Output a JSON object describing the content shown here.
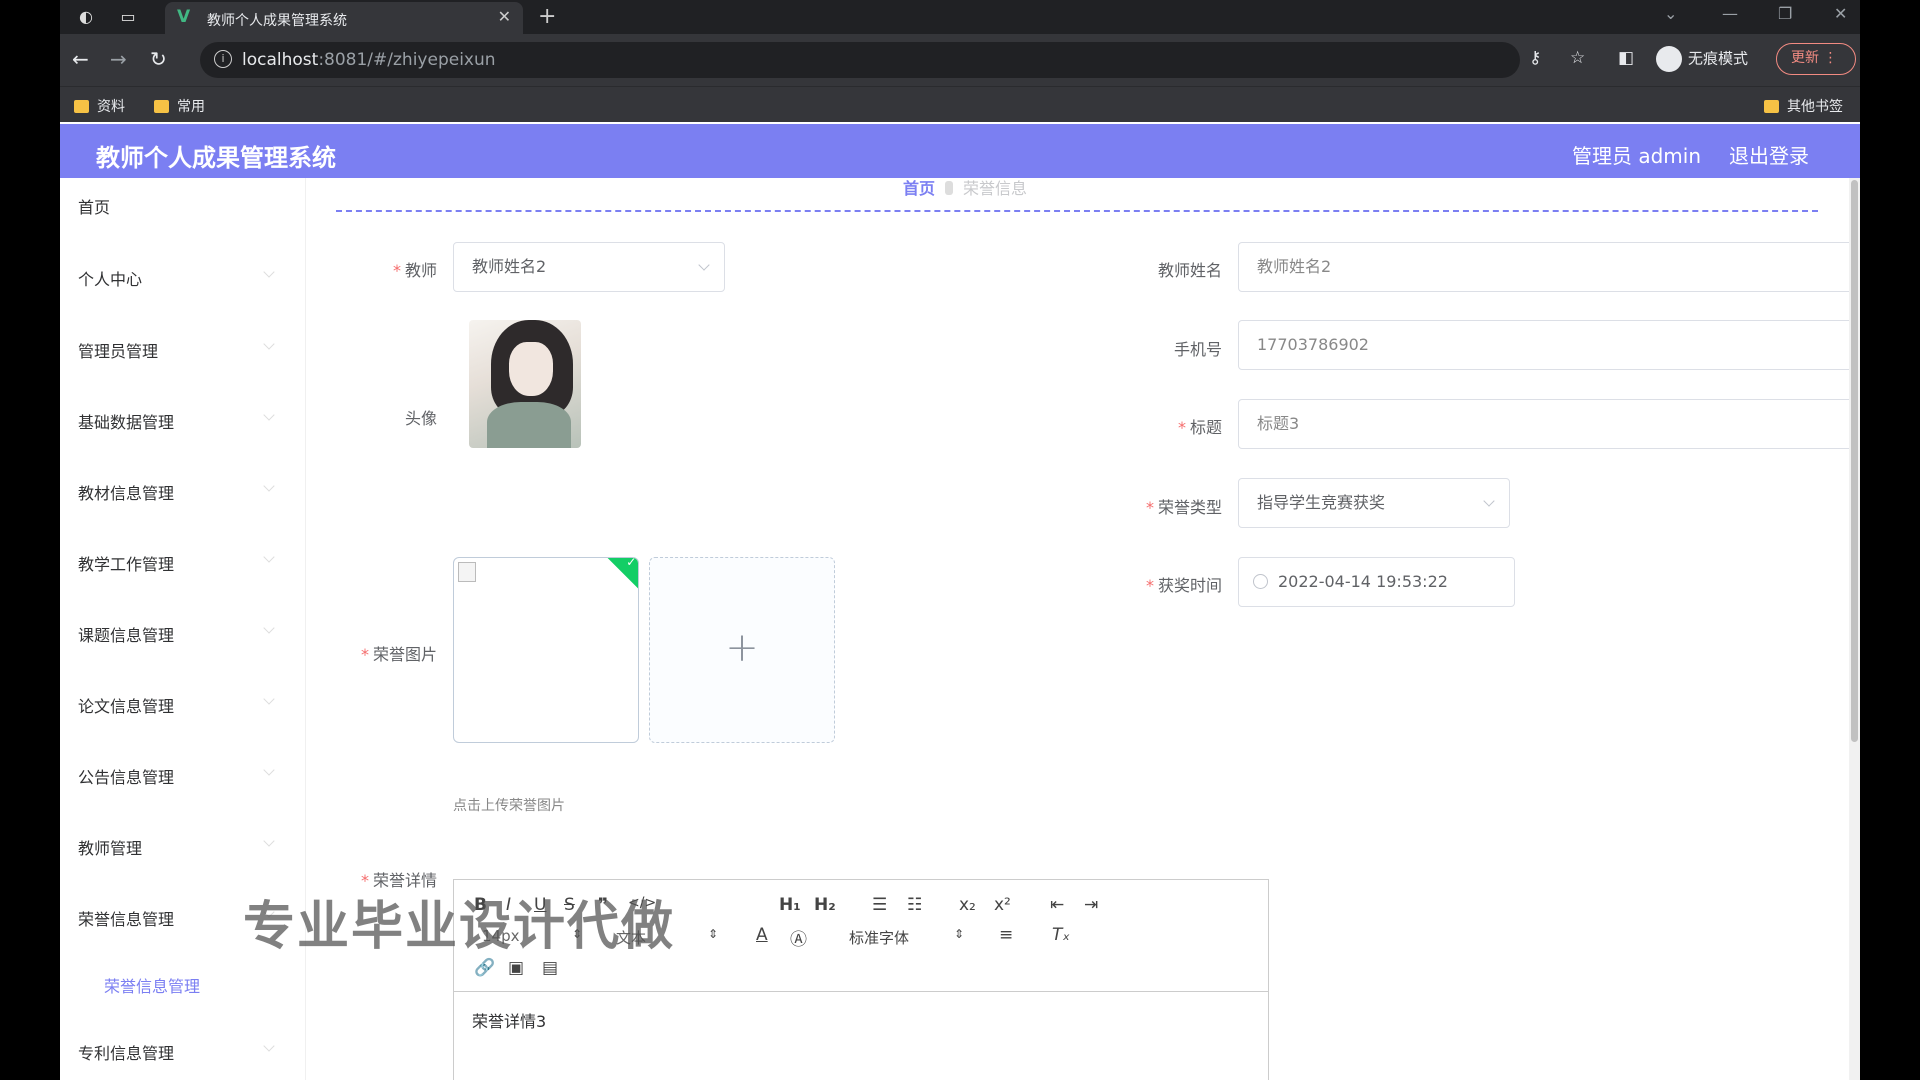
{
  "browser": {
    "tab_title": "教师个人成果管理系统",
    "url_host": "localhost",
    "url_path": ":8081/#/zhiyepeixun",
    "incognito_label": "无痕模式",
    "update_label": "更新",
    "bookmarks": [
      "资料",
      "常用"
    ],
    "other_bookmarks": "其他书签"
  },
  "header": {
    "title": "教师个人成果管理系统",
    "user": "管理员 admin",
    "logout": "退出登录"
  },
  "sidebar": {
    "items": [
      {
        "label": "首页"
      },
      {
        "label": "个人中心"
      },
      {
        "label": "管理员管理"
      },
      {
        "label": "基础数据管理"
      },
      {
        "label": "教材信息管理"
      },
      {
        "label": "教学工作管理"
      },
      {
        "label": "课题信息管理"
      },
      {
        "label": "论文信息管理"
      },
      {
        "label": "公告信息管理"
      },
      {
        "label": "教师管理"
      },
      {
        "label": "荣誉信息管理"
      },
      {
        "label": "专利信息管理"
      }
    ],
    "active_sub": "荣誉信息管理"
  },
  "breadcrumb": {
    "home": "首页",
    "current": "荣誉信息"
  },
  "form": {
    "teacher": {
      "label": "教师",
      "value": "教师姓名2"
    },
    "teacher_name": {
      "label": "教师姓名",
      "value": "教师姓名2"
    },
    "avatar": {
      "label": "头像"
    },
    "phone": {
      "label": "手机号",
      "value": "17703786902"
    },
    "title": {
      "label": "标题",
      "value": "标题3"
    },
    "honor_type": {
      "label": "荣誉类型",
      "value": "指导学生竞赛获奖"
    },
    "award_time": {
      "label": "获奖时间",
      "value": "2022-04-14 19:53:22"
    },
    "honor_image": {
      "label": "荣誉图片",
      "hint": "点击上传荣誉图片"
    },
    "honor_detail": {
      "label": "荣誉详情",
      "content": "荣誉详情3"
    }
  },
  "editor": {
    "font_size": "14px",
    "paragraph": "文本",
    "font_family": "标准字体"
  },
  "watermark": "专业毕业设计代做"
}
